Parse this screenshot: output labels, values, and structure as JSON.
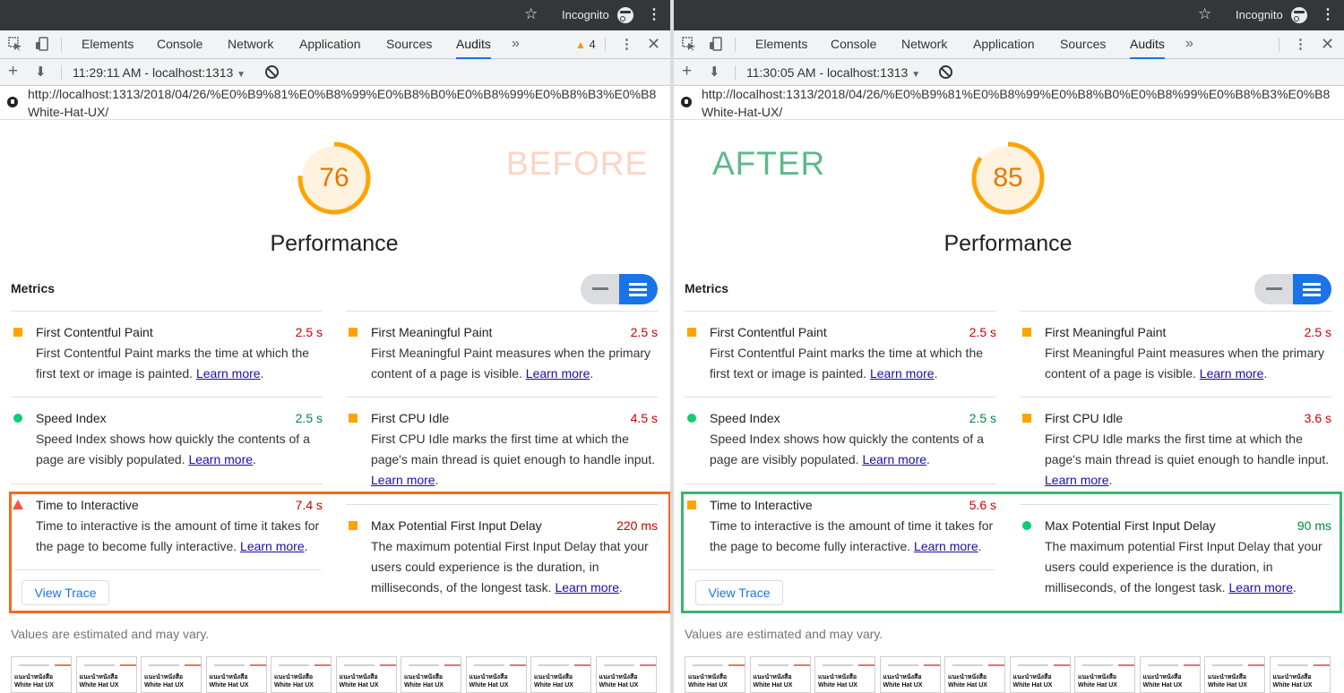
{
  "browser": {
    "incognito_label": "Incognito"
  },
  "devtools": {
    "tabs": [
      "Elements",
      "Console",
      "Network",
      "Application",
      "Sources",
      "Audits"
    ],
    "active_tab": "Audits",
    "warning_count": "4"
  },
  "metrics_label": "Metrics",
  "performance_label": "Performance",
  "estimate_note": "Values are estimated and may vary.",
  "view_trace_label": "View Trace",
  "learn_more": "Learn more",
  "url_line1": "http://localhost:1313/2018/04/26/%E0%B9%81%E0%B8%99%E0%B8%B0%E0%B8%99%E0%B8%B3%E0%B8",
  "url_line2": "White-Hat-UX/",
  "filmstrip_caption_top": "แนะนำหนังสือ",
  "filmstrip_caption_bottom": "White Hat UX",
  "colors": {
    "before_border": "#f26b21",
    "after_border": "#3cb371",
    "before_stamp": "#fbd5c5",
    "after_stamp": "#5db88a",
    "gauge": "#ffa400",
    "warn_red": "#cc0000",
    "good_green": "#018642"
  },
  "descriptions": {
    "fcp": "First Contentful Paint marks the time at which the first text or image is painted.",
    "fmp": "First Meaningful Paint measures when the primary content of a page is visible.",
    "si": "Speed Index shows how quickly the contents of a page are visibly populated.",
    "fci": "First CPU Idle marks the first time at which the page's main thread is quiet enough to handle input.",
    "tti": "Time to interactive is the amount of time it takes for the page to become fully interactive.",
    "mpfid": "The maximum potential First Input Delay that your users could experience is the duration, in milliseconds, of the longest task."
  },
  "titles": {
    "fcp": "First Contentful Paint",
    "fmp": "First Meaningful Paint",
    "si": "Speed Index",
    "fci": "First CPU Idle",
    "tti": "Time to Interactive",
    "mpfid": "Max Potential First Input Delay"
  },
  "before": {
    "stamp": "BEFORE",
    "report_label": "11:29:11 AM - localhost:1313",
    "score": 76,
    "score_text": "76",
    "values": {
      "fcp": "2.5 s",
      "fmp": "2.5 s",
      "si": "2.5 s",
      "fci": "4.5 s",
      "tti": "7.4 s",
      "mpfid": "220 ms"
    }
  },
  "after": {
    "stamp": "AFTER",
    "report_label": "11:30:05 AM - localhost:1313",
    "score": 85,
    "score_text": "85",
    "values": {
      "fcp": "2.5 s",
      "fmp": "2.5 s",
      "si": "2.5 s",
      "fci": "3.6 s",
      "tti": "5.6 s",
      "mpfid": "90 ms"
    }
  }
}
